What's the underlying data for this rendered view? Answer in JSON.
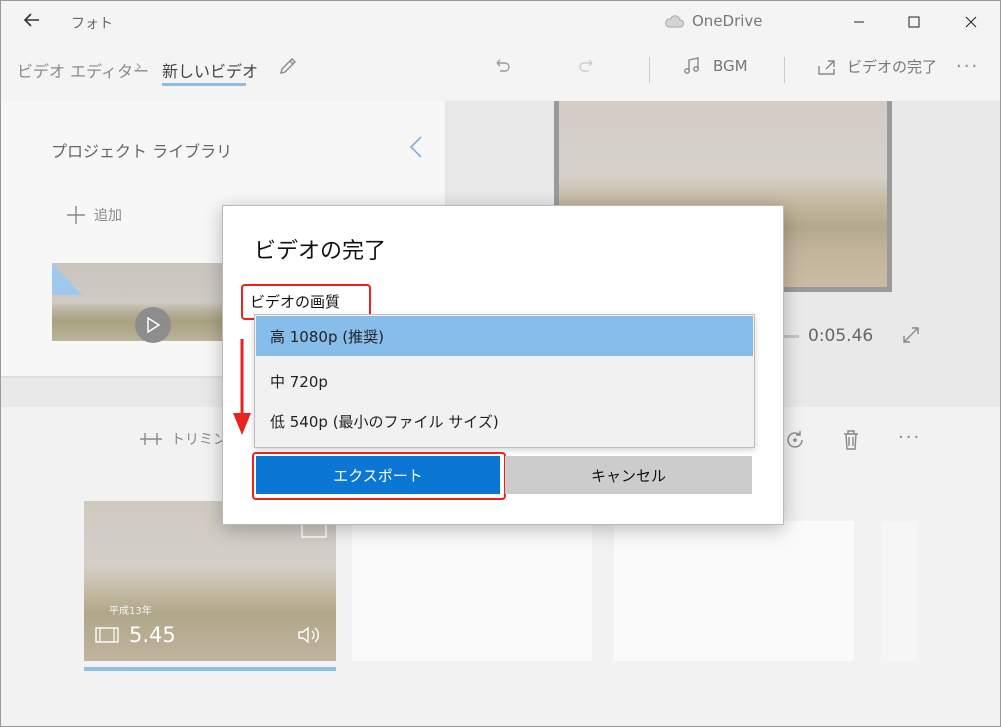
{
  "titlebar": {
    "app_title": "フォト",
    "onedrive_label": "OneDrive"
  },
  "toolbar": {
    "breadcrumb_root": "ビデオ エディター",
    "breadcrumb_current": "新しいビデオ",
    "bgm_label": "BGM",
    "finish_label": "ビデオの完了"
  },
  "library": {
    "title": "プロジェクト ライブラリ",
    "add_label": "追加"
  },
  "preview": {
    "time": "0:05.46"
  },
  "storyboard": {
    "trim_label": "トリミング",
    "clip1_date": "平成13年",
    "clip1_duration": "5.45"
  },
  "dialog": {
    "title": "ビデオの完了",
    "quality_label": "ビデオの画質",
    "options": [
      {
        "label": "高 1080p (推奨)",
        "selected": true
      },
      {
        "label": "中 720p",
        "selected": false
      },
      {
        "label": "低 540p (最小のファイル サイズ)",
        "selected": false
      }
    ],
    "export_label": "エクスポート",
    "cancel_label": "キャンセル"
  },
  "colors": {
    "accent": "#0a77d4",
    "selected_option": "#87bdea",
    "highlight": "#e8231f"
  }
}
